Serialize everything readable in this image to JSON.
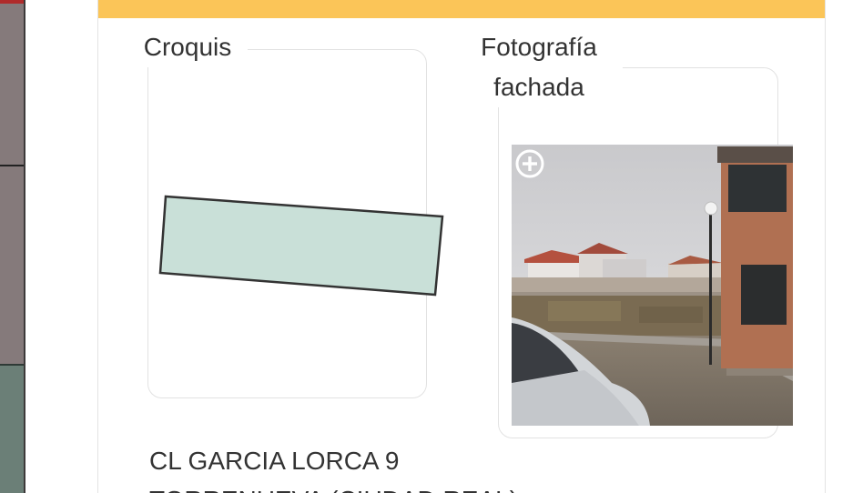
{
  "card": {
    "croquis_label": "Croquis",
    "foto_label_line1": "Fotografía",
    "foto_label_line2": "fachada",
    "address_line1": "CL GARCIA LORCA 9",
    "address_line2": "TORRENUEVA (CIUDAD REAL)"
  },
  "colors": {
    "header_bar": "#fbc558",
    "parcel_fill": "#c9e0d8",
    "parcel_stroke": "#333333",
    "text": "#333333"
  },
  "icons": {
    "zoom": "plus-circle-icon"
  }
}
